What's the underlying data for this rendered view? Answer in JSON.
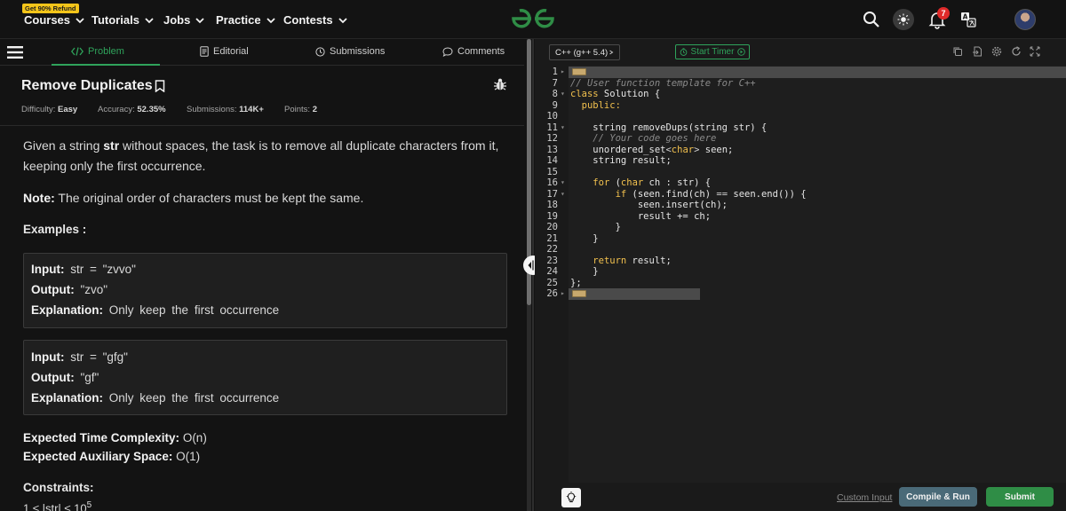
{
  "topnav": {
    "refund_badge": "Get 90% Refund",
    "items": [
      {
        "label": "Courses"
      },
      {
        "label": "Tutorials"
      },
      {
        "label": "Jobs"
      },
      {
        "label": "Practice"
      },
      {
        "label": "Contests"
      }
    ],
    "notification_count": "7"
  },
  "tabs": {
    "problem": "Problem",
    "editorial": "Editorial",
    "submissions": "Submissions",
    "comments": "Comments"
  },
  "problem": {
    "title": "Remove Duplicates",
    "difficulty_label": "Difficulty:",
    "difficulty": "Easy",
    "accuracy_label": "Accuracy:",
    "accuracy": "52.35%",
    "submissions_label": "Submissions:",
    "submissions": "114K+",
    "points_label": "Points:",
    "points": "2",
    "desc_1_pre": "Given a string ",
    "desc_1_bold": "str",
    "desc_1_post": " without spaces, the task is to remove all duplicate characters from it,",
    "desc_2": "keeping only the first occurrence.",
    "note_label": "Note:",
    "note_text": " The original order of characters must be kept the same.",
    "examples_heading": "Examples :",
    "examples": [
      {
        "input_label": "Input:",
        "input": " str = \"zvvo\"",
        "output_label": "Output:",
        "output": " \"zvo\"",
        "explanation_label": "Explanation:",
        "explanation": " Only keep the first occurrence"
      },
      {
        "input_label": "Input:",
        "input": " str = \"gfg\"",
        "output_label": "Output:",
        "output": " \"gf\"",
        "explanation_label": "Explanation:",
        "explanation": " Only keep the first occurrence"
      }
    ],
    "time_label": "Expected Time Complexity:",
    "time_value": " O(n)",
    "space_label": "Expected Auxiliary Space:",
    "space_value": " O(1)",
    "constraints_heading": "Constraints:",
    "constraint_partial": "1 ≤ |str| ≤ 10",
    "constraint_exp": "5"
  },
  "editor": {
    "language": "C++ (g++ 5.4)",
    "timer_label": "Start Timer",
    "line_numbers": [
      "1",
      "7",
      "8",
      "9",
      "10",
      "11",
      "12",
      "13",
      "14",
      "15",
      "16",
      "17",
      "18",
      "19",
      "20",
      "21",
      "22",
      "23",
      "24",
      "25",
      "26"
    ],
    "lines": [
      "",
      "// User function template for C++",
      "class Solution {",
      "  public:",
      "",
      "    string removeDups(string str) {",
      "    // Your code goes here",
      "    unordered_set<char> seen;",
      "    string result;",
      "",
      "    for (char ch : str) {",
      "        if (seen.find(ch) == seen.end()) {",
      "            seen.insert(ch);",
      "            result += ch;",
      "        }",
      "    }",
      "",
      "    return result;",
      "    }",
      "};",
      ""
    ],
    "custom_input": "Custom Input",
    "compile_run": "Compile & Run",
    "submit": "Submit"
  }
}
